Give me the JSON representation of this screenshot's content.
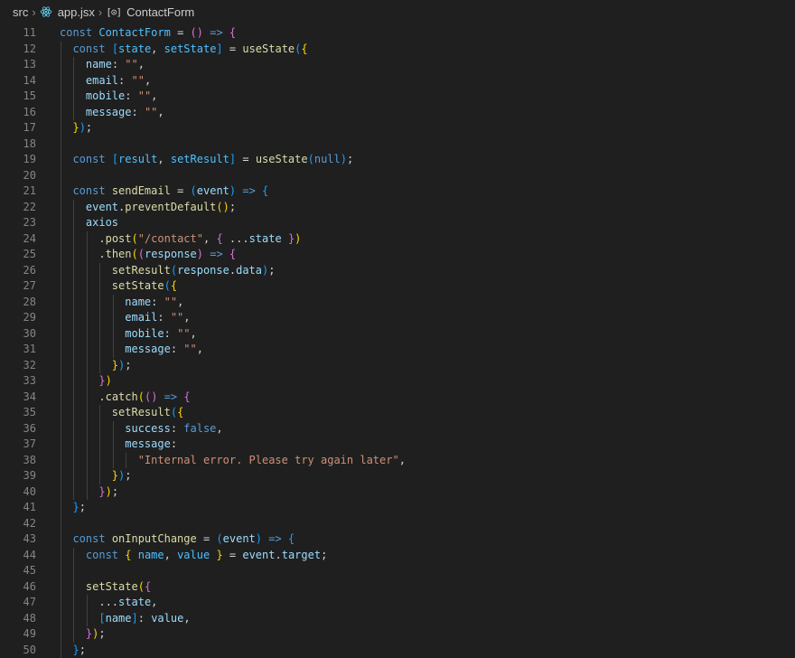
{
  "breadcrumb": {
    "folder": "src",
    "file": "app.jsx",
    "symbol": "ContactForm"
  },
  "icons": {
    "chevron": "chevron-right-icon",
    "file_icon": "react-icon",
    "symbol_icon": "symbol-variable-icon"
  },
  "colors": {
    "background": "#1f1f1f",
    "line_number": "#858585",
    "keyword": "#569cd6",
    "control_keyword": "#c586c0",
    "function": "#dcdcaa",
    "variable": "#9cdcfe",
    "string": "#ce9178",
    "bracket_gold": "#ffd700",
    "bracket_orchid": "#da70d6",
    "bracket_blue": "#179fff"
  },
  "editor": {
    "lines": [
      {
        "n": "11",
        "tokens": [
          [
            "const ",
            "key"
          ],
          [
            "ContactForm",
            "const"
          ],
          [
            " = ",
            "p"
          ],
          [
            "(",
            "b2"
          ],
          [
            ")",
            "b2"
          ],
          [
            " => ",
            "key"
          ],
          [
            "{",
            "b2"
          ]
        ]
      },
      {
        "n": "12",
        "tokens": [
          [
            "  ",
            ""
          ],
          [
            "const ",
            "key"
          ],
          [
            "[",
            "b3"
          ],
          [
            "state",
            "const"
          ],
          [
            ", ",
            "p"
          ],
          [
            "setState",
            "const"
          ],
          [
            "]",
            "b3"
          ],
          [
            " = ",
            "p"
          ],
          [
            "useState",
            "fn"
          ],
          [
            "(",
            "b3"
          ],
          [
            "{",
            "b1"
          ]
        ]
      },
      {
        "n": "13",
        "tokens": [
          [
            "    ",
            ""
          ],
          [
            "name",
            "var"
          ],
          [
            ": ",
            "p"
          ],
          [
            "\"\"",
            "str"
          ],
          [
            ",",
            "p"
          ]
        ]
      },
      {
        "n": "14",
        "tokens": [
          [
            "    ",
            ""
          ],
          [
            "email",
            "var"
          ],
          [
            ": ",
            "p"
          ],
          [
            "\"\"",
            "str"
          ],
          [
            ",",
            "p"
          ]
        ]
      },
      {
        "n": "15",
        "tokens": [
          [
            "    ",
            ""
          ],
          [
            "mobile",
            "var"
          ],
          [
            ": ",
            "p"
          ],
          [
            "\"\"",
            "str"
          ],
          [
            ",",
            "p"
          ]
        ]
      },
      {
        "n": "16",
        "tokens": [
          [
            "    ",
            ""
          ],
          [
            "message",
            "var"
          ],
          [
            ": ",
            "p"
          ],
          [
            "\"\"",
            "str"
          ],
          [
            ",",
            "p"
          ]
        ]
      },
      {
        "n": "17",
        "tokens": [
          [
            "  ",
            ""
          ],
          [
            "}",
            "b1"
          ],
          [
            ")",
            "b3"
          ],
          [
            ";",
            "p"
          ]
        ]
      },
      {
        "n": "18",
        "tokens": []
      },
      {
        "n": "19",
        "tokens": [
          [
            "  ",
            ""
          ],
          [
            "const ",
            "key"
          ],
          [
            "[",
            "b3"
          ],
          [
            "result",
            "const"
          ],
          [
            ", ",
            "p"
          ],
          [
            "setResult",
            "const"
          ],
          [
            "]",
            "b3"
          ],
          [
            " = ",
            "p"
          ],
          [
            "useState",
            "fn"
          ],
          [
            "(",
            "b3"
          ],
          [
            "null",
            "key"
          ],
          [
            ")",
            "b3"
          ],
          [
            ";",
            "p"
          ]
        ]
      },
      {
        "n": "20",
        "tokens": []
      },
      {
        "n": "21",
        "tokens": [
          [
            "  ",
            ""
          ],
          [
            "const ",
            "key"
          ],
          [
            "sendEmail",
            "fn"
          ],
          [
            " = ",
            "p"
          ],
          [
            "(",
            "b3"
          ],
          [
            "event",
            "var"
          ],
          [
            ")",
            "b3"
          ],
          [
            " => ",
            "key"
          ],
          [
            "{",
            "b3"
          ]
        ]
      },
      {
        "n": "22",
        "tokens": [
          [
            "    ",
            ""
          ],
          [
            "event",
            "var"
          ],
          [
            ".",
            "p"
          ],
          [
            "preventDefault",
            "fn"
          ],
          [
            "(",
            "b1"
          ],
          [
            ")",
            "b1"
          ],
          [
            ";",
            "p"
          ]
        ]
      },
      {
        "n": "23",
        "tokens": [
          [
            "    ",
            ""
          ],
          [
            "axios",
            "var"
          ]
        ]
      },
      {
        "n": "24",
        "tokens": [
          [
            "      ",
            ""
          ],
          [
            ".",
            "p"
          ],
          [
            "post",
            "fn"
          ],
          [
            "(",
            "b1"
          ],
          [
            "\"/contact\"",
            "str"
          ],
          [
            ", ",
            "p"
          ],
          [
            "{",
            "b2"
          ],
          [
            " ...",
            "p"
          ],
          [
            "state",
            "var"
          ],
          [
            " ",
            "p"
          ],
          [
            "}",
            "b2"
          ],
          [
            ")",
            "b1"
          ]
        ]
      },
      {
        "n": "25",
        "tokens": [
          [
            "      ",
            ""
          ],
          [
            ".",
            "p"
          ],
          [
            "then",
            "fn"
          ],
          [
            "(",
            "b1"
          ],
          [
            "(",
            "b2"
          ],
          [
            "response",
            "var"
          ],
          [
            ")",
            "b2"
          ],
          [
            " => ",
            "key"
          ],
          [
            "{",
            "b2"
          ]
        ]
      },
      {
        "n": "26",
        "tokens": [
          [
            "        ",
            ""
          ],
          [
            "setResult",
            "fn"
          ],
          [
            "(",
            "b3"
          ],
          [
            "response",
            "var"
          ],
          [
            ".",
            "p"
          ],
          [
            "data",
            "var"
          ],
          [
            ")",
            "b3"
          ],
          [
            ";",
            "p"
          ]
        ]
      },
      {
        "n": "27",
        "tokens": [
          [
            "        ",
            ""
          ],
          [
            "setState",
            "fn"
          ],
          [
            "(",
            "b3"
          ],
          [
            "{",
            "b1"
          ]
        ]
      },
      {
        "n": "28",
        "tokens": [
          [
            "          ",
            ""
          ],
          [
            "name",
            "var"
          ],
          [
            ": ",
            "p"
          ],
          [
            "\"\"",
            "str"
          ],
          [
            ",",
            "p"
          ]
        ]
      },
      {
        "n": "29",
        "tokens": [
          [
            "          ",
            ""
          ],
          [
            "email",
            "var"
          ],
          [
            ": ",
            "p"
          ],
          [
            "\"\"",
            "str"
          ],
          [
            ",",
            "p"
          ]
        ]
      },
      {
        "n": "30",
        "tokens": [
          [
            "          ",
            ""
          ],
          [
            "mobile",
            "var"
          ],
          [
            ": ",
            "p"
          ],
          [
            "\"\"",
            "str"
          ],
          [
            ",",
            "p"
          ]
        ]
      },
      {
        "n": "31",
        "tokens": [
          [
            "          ",
            ""
          ],
          [
            "message",
            "var"
          ],
          [
            ": ",
            "p"
          ],
          [
            "\"\"",
            "str"
          ],
          [
            ",",
            "p"
          ]
        ]
      },
      {
        "n": "32",
        "tokens": [
          [
            "        ",
            ""
          ],
          [
            "}",
            "b1"
          ],
          [
            ")",
            "b3"
          ],
          [
            ";",
            "p"
          ]
        ]
      },
      {
        "n": "33",
        "tokens": [
          [
            "      ",
            ""
          ],
          [
            "}",
            "b2"
          ],
          [
            ")",
            "b1"
          ]
        ]
      },
      {
        "n": "34",
        "tokens": [
          [
            "      ",
            ""
          ],
          [
            ".",
            "p"
          ],
          [
            "catch",
            "fn"
          ],
          [
            "(",
            "b1"
          ],
          [
            "(",
            "b2"
          ],
          [
            ")",
            "b2"
          ],
          [
            " => ",
            "key"
          ],
          [
            "{",
            "b2"
          ]
        ]
      },
      {
        "n": "35",
        "tokens": [
          [
            "        ",
            ""
          ],
          [
            "setResult",
            "fn"
          ],
          [
            "(",
            "b3"
          ],
          [
            "{",
            "b1"
          ]
        ]
      },
      {
        "n": "36",
        "tokens": [
          [
            "          ",
            ""
          ],
          [
            "success",
            "var"
          ],
          [
            ": ",
            "p"
          ],
          [
            "false",
            "key"
          ],
          [
            ",",
            "p"
          ]
        ]
      },
      {
        "n": "37",
        "tokens": [
          [
            "          ",
            ""
          ],
          [
            "message",
            "var"
          ],
          [
            ":",
            "p"
          ]
        ]
      },
      {
        "n": "38",
        "tokens": [
          [
            "            ",
            ""
          ],
          [
            "\"Internal error. Please try again later\"",
            "str"
          ],
          [
            ",",
            "p"
          ]
        ]
      },
      {
        "n": "39",
        "tokens": [
          [
            "        ",
            ""
          ],
          [
            "}",
            "b1"
          ],
          [
            ")",
            "b3"
          ],
          [
            ";",
            "p"
          ]
        ]
      },
      {
        "n": "40",
        "tokens": [
          [
            "      ",
            ""
          ],
          [
            "}",
            "b2"
          ],
          [
            ")",
            "b1"
          ],
          [
            ";",
            "p"
          ]
        ]
      },
      {
        "n": "41",
        "tokens": [
          [
            "  ",
            ""
          ],
          [
            "}",
            "b3"
          ],
          [
            ";",
            "p"
          ]
        ]
      },
      {
        "n": "42",
        "tokens": []
      },
      {
        "n": "43",
        "tokens": [
          [
            "  ",
            ""
          ],
          [
            "const ",
            "key"
          ],
          [
            "onInputChange",
            "fn"
          ],
          [
            " = ",
            "p"
          ],
          [
            "(",
            "b3"
          ],
          [
            "event",
            "var"
          ],
          [
            ")",
            "b3"
          ],
          [
            " => ",
            "key"
          ],
          [
            "{",
            "b3"
          ]
        ]
      },
      {
        "n": "44",
        "tokens": [
          [
            "    ",
            ""
          ],
          [
            "const ",
            "key"
          ],
          [
            "{",
            "b1"
          ],
          [
            " name",
            "const"
          ],
          [
            ", ",
            "p"
          ],
          [
            "value",
            "const"
          ],
          [
            " ",
            "p"
          ],
          [
            "}",
            "b1"
          ],
          [
            " = ",
            "p"
          ],
          [
            "event",
            "var"
          ],
          [
            ".",
            "p"
          ],
          [
            "target",
            "var"
          ],
          [
            ";",
            "p"
          ]
        ]
      },
      {
        "n": "45",
        "tokens": []
      },
      {
        "n": "46",
        "tokens": [
          [
            "    ",
            ""
          ],
          [
            "setState",
            "fn"
          ],
          [
            "(",
            "b1"
          ],
          [
            "{",
            "b2"
          ]
        ]
      },
      {
        "n": "47",
        "tokens": [
          [
            "      ",
            ""
          ],
          [
            "...",
            "p"
          ],
          [
            "state",
            "var"
          ],
          [
            ",",
            "p"
          ]
        ]
      },
      {
        "n": "48",
        "tokens": [
          [
            "      ",
            ""
          ],
          [
            "[",
            "b3"
          ],
          [
            "name",
            "var"
          ],
          [
            "]",
            "b3"
          ],
          [
            ": ",
            "p"
          ],
          [
            "value",
            "var"
          ],
          [
            ",",
            "p"
          ]
        ]
      },
      {
        "n": "49",
        "tokens": [
          [
            "    ",
            ""
          ],
          [
            "}",
            "b2"
          ],
          [
            ")",
            "b1"
          ],
          [
            ";",
            "p"
          ]
        ]
      },
      {
        "n": "50",
        "tokens": [
          [
            "  ",
            ""
          ],
          [
            "}",
            "b3"
          ],
          [
            ";",
            "p"
          ]
        ]
      }
    ]
  }
}
